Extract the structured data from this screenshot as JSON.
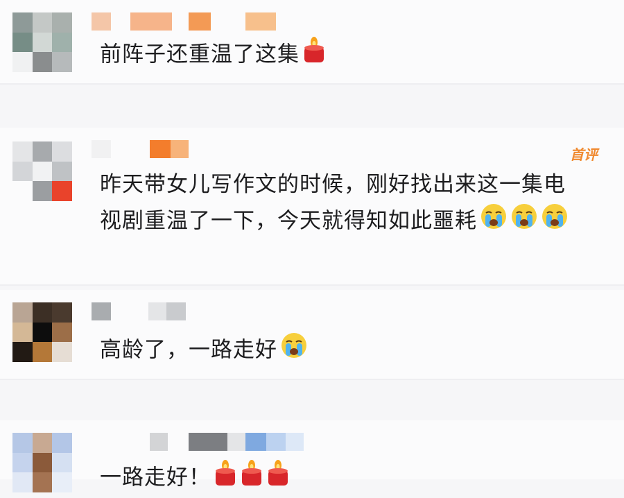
{
  "comments": [
    {
      "text": "前阵子还重温了这集",
      "emoji": "candle-icon"
    },
    {
      "badge": "首评",
      "line1": "昨天带女儿写作文的时候，刚好找出来这一集电",
      "line2": "视剧重温了一下，今天就得知如此噩耗",
      "emoji": "crying-face-icon"
    },
    {
      "text": "高龄了，一路走好",
      "emoji": "crying-face-icon"
    },
    {
      "text": "一路走好！",
      "emoji": "candle-icon"
    }
  ],
  "colors": {
    "accent": "#f08a30",
    "text": "#1d1d1f",
    "candle": "#d8262a"
  }
}
